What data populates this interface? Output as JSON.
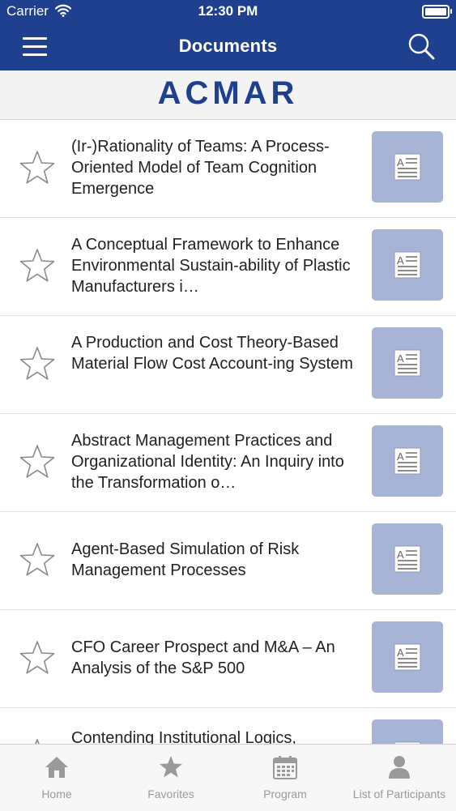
{
  "status_bar": {
    "carrier": "Carrier",
    "time": "12:30 PM"
  },
  "nav": {
    "title": "Documents",
    "menu_icon": "hamburger-menu-icon",
    "search_icon": "search-icon",
    "color": "#1f3f8f"
  },
  "banner": {
    "text": "ACMAR",
    "color": "#1f3f8f"
  },
  "documents": [
    {
      "title": "(Ir-)Rationality of Teams: A Process-Oriented Model of Team Cognition Emergence",
      "favorite": false
    },
    {
      "title": "A Conceptual Framework to Enhance Environmental Sustain-ability of Plastic Manufacturers i…",
      "favorite": false
    },
    {
      "title": "A Production and Cost Theory-Based Material Flow Cost Account-ing System",
      "favorite": false
    },
    {
      "title": "Abstract Management Practices and Organizational Identity: An Inquiry into the Transformation o…",
      "favorite": false
    },
    {
      "title": "Agent-Based Simulation of Risk Management Processes",
      "favorite": false
    },
    {
      "title": "CFO Career  Prospect and M&A – An Analysis of the S&P 500",
      "favorite": false
    },
    {
      "title": "Contending Institutional Logics,",
      "favorite": false
    }
  ],
  "thumbnail_color": "#a8b4d6",
  "tabs": [
    {
      "label": "Home",
      "icon": "home-icon"
    },
    {
      "label": "Favorites",
      "icon": "star-icon"
    },
    {
      "label": "Program",
      "icon": "calendar-icon"
    },
    {
      "label": "List of Participants",
      "icon": "person-icon"
    }
  ]
}
